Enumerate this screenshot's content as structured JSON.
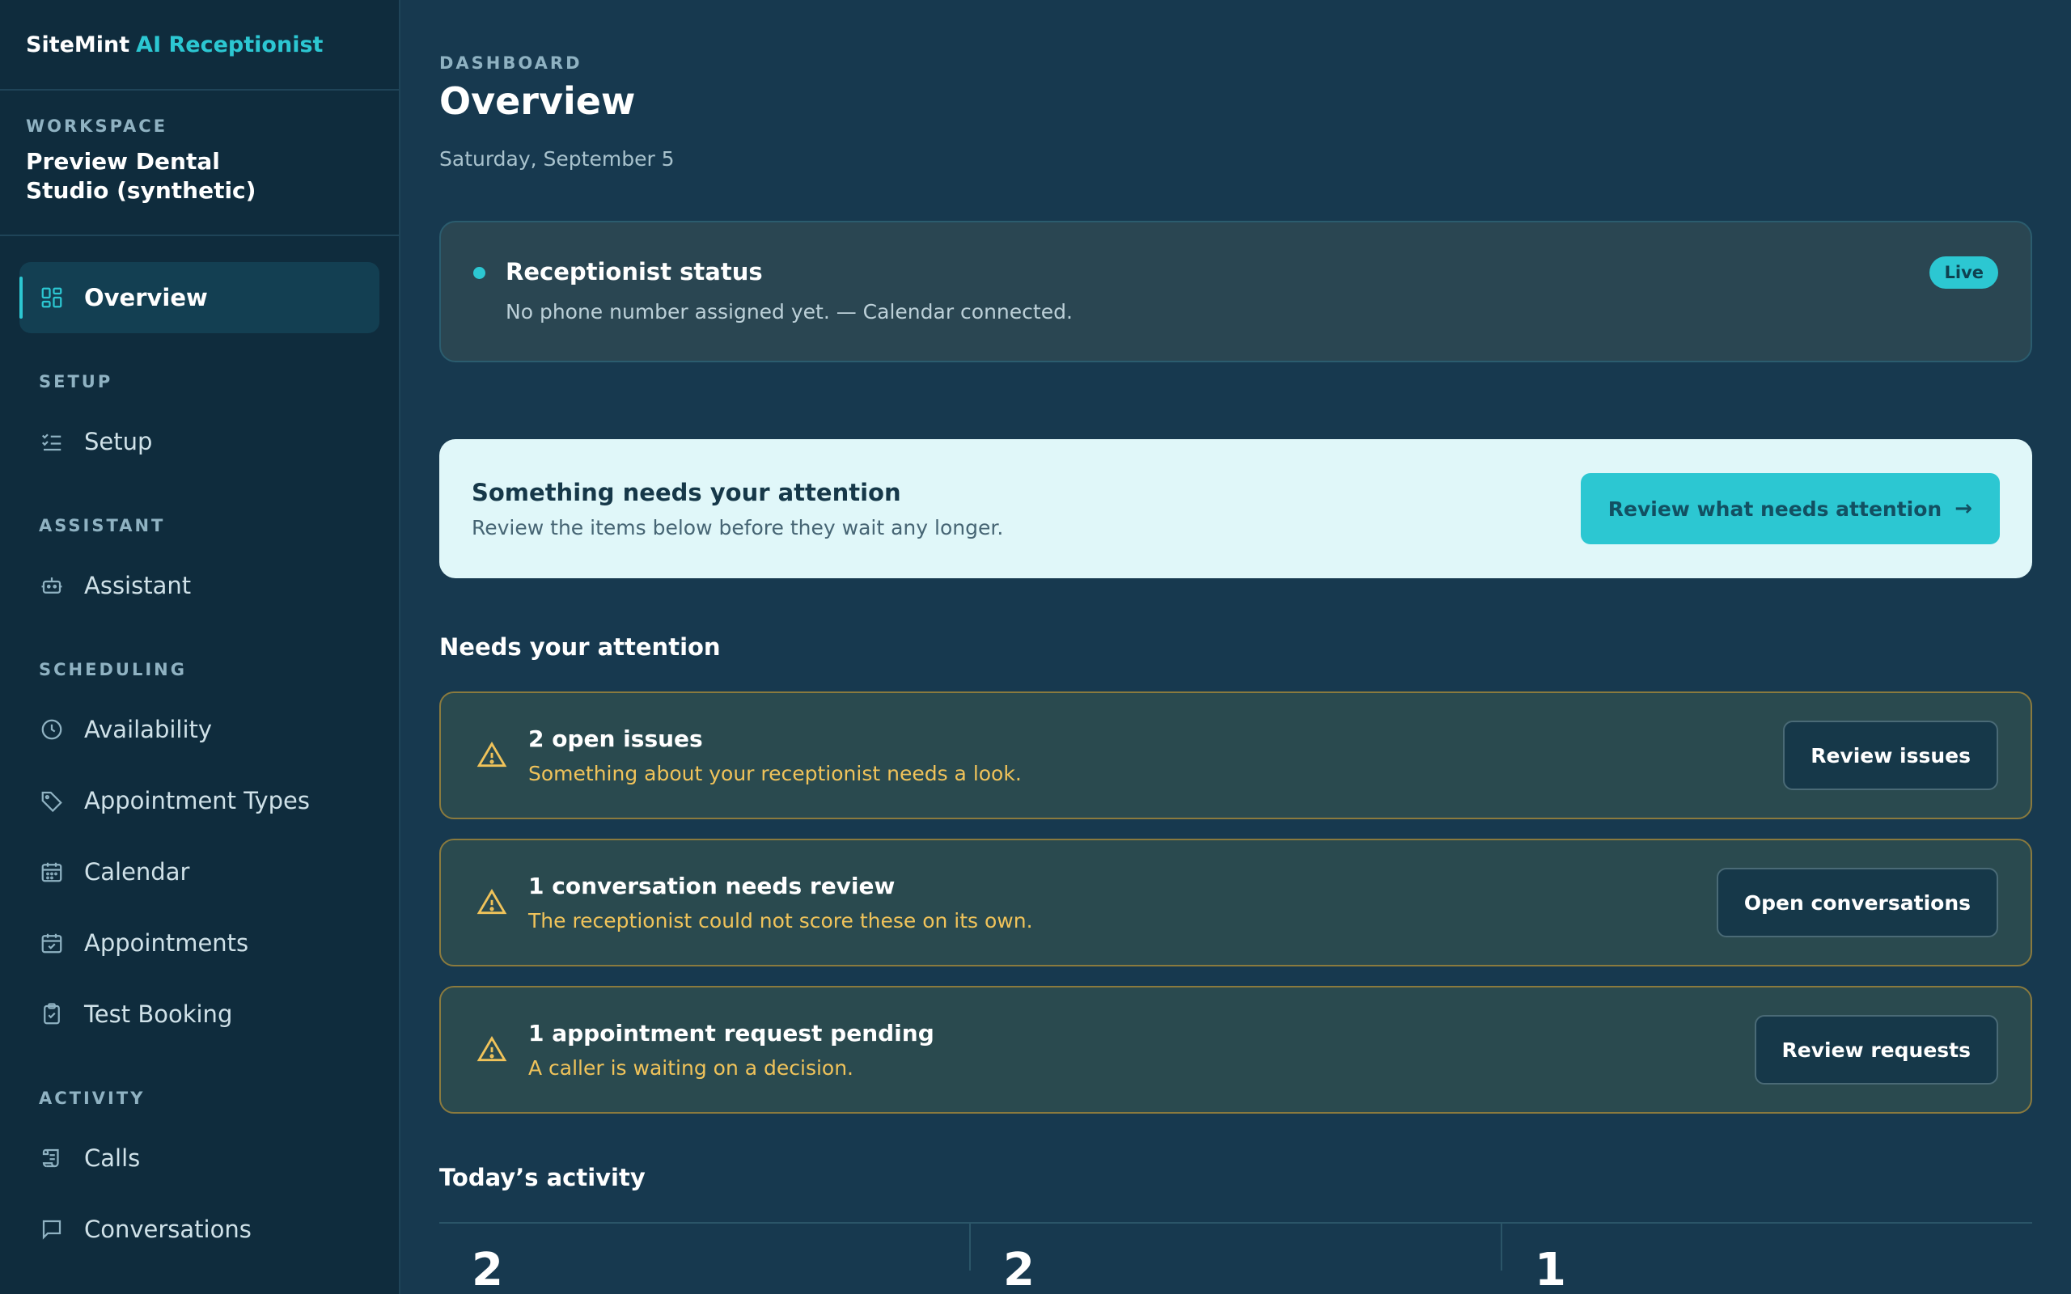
{
  "brand": {
    "name": "SiteMint",
    "product": "AI Receptionist"
  },
  "workspace": {
    "label": "WORKSPACE",
    "name": "Preview Dental Studio (synthetic)"
  },
  "nav": {
    "overview": "Overview",
    "sections": {
      "setup": "SETUP",
      "assistant": "ASSISTANT",
      "scheduling": "SCHEDULING",
      "activity": "ACTIVITY"
    },
    "items": {
      "setup": "Setup",
      "assistant": "Assistant",
      "availability": "Availability",
      "appointment_types": "Appointment Types",
      "calendar": "Calendar",
      "appointments": "Appointments",
      "test_booking": "Test Booking",
      "calls": "Calls",
      "conversations": "Conversations"
    },
    "active": "overview"
  },
  "header": {
    "eyebrow": "DASHBOARD",
    "title": "Overview",
    "date": "Saturday, September 5"
  },
  "status": {
    "title": "Receptionist status",
    "text": "No phone number assigned yet. — Calendar connected.",
    "badge": "Live"
  },
  "attention": {
    "title": "Something needs your attention",
    "text": "Review the items below before they wait any longer.",
    "button": "Review what needs attention",
    "button_arrow": "→"
  },
  "needs_attention": {
    "heading": "Needs your attention",
    "items": [
      {
        "title": "2 open issues",
        "text": "Something about your receptionist needs a look.",
        "button": "Review issues"
      },
      {
        "title": "1 conversation needs review",
        "text": "The receptionist could not score these on its own.",
        "button": "Open conversations"
      },
      {
        "title": "1 appointment request pending",
        "text": "A caller is waiting on a decision.",
        "button": "Review requests"
      }
    ]
  },
  "activity": {
    "heading": "Today’s activity",
    "stats": [
      "2",
      "2",
      "1"
    ]
  },
  "colors": {
    "accent": "#2cc7d2",
    "warning": "#f0c35a",
    "sidebar_bg": "#0f2c3d",
    "main_bg": "#17394f",
    "banner_bg": "#e0f7f9"
  }
}
